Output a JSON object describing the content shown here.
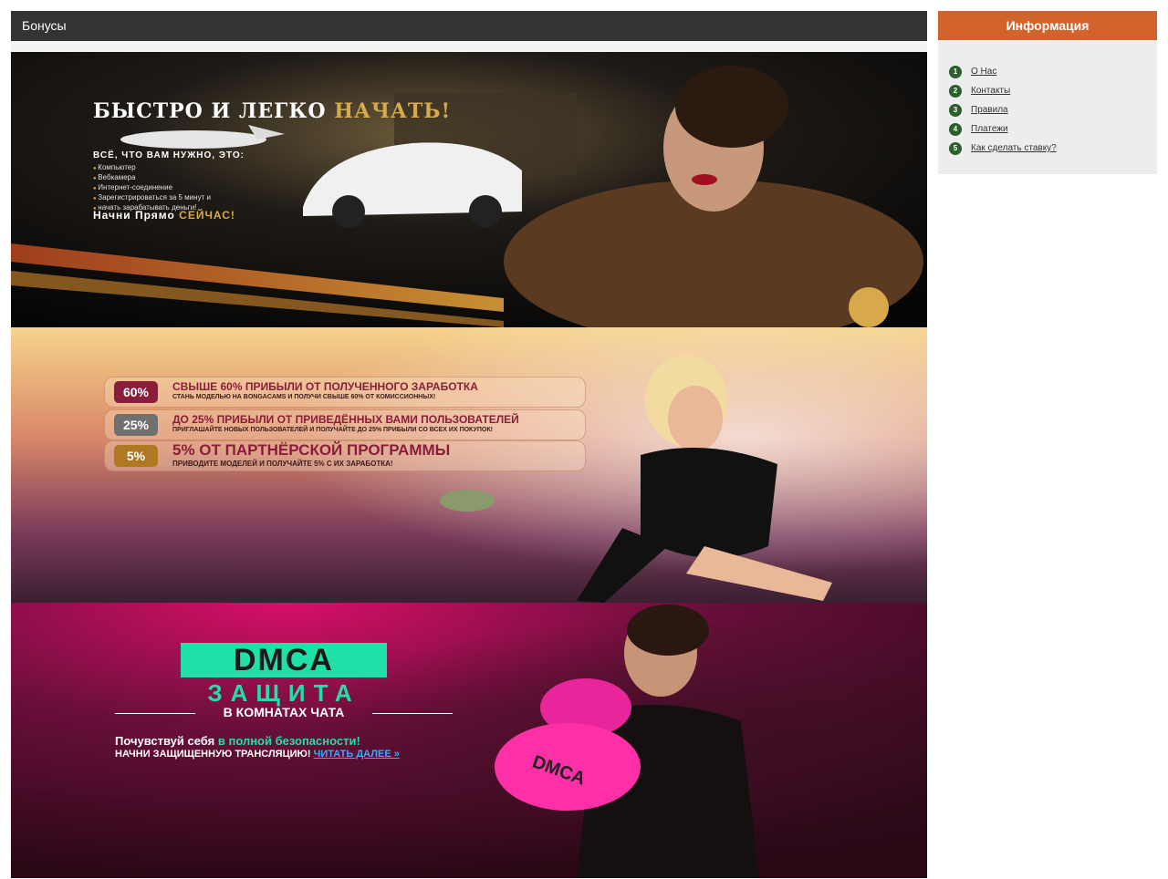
{
  "main": {
    "title": "Бонусы"
  },
  "banner1": {
    "title_white": "БЫСТРО И ЛЕГКО",
    "title_gold": "НАЧАТЬ!",
    "subtitle": "ВСЁ, ЧТО ВАМ НУЖНО, ЭТО:",
    "list": [
      "Компьютер",
      "Вебкамера",
      "Интернет-соединение",
      "Зарегистрироваться за 5 минут и",
      "начать зарабатывать деньги!"
    ],
    "cta_white": "Начни Прямо",
    "cta_gold": "СЕЙЧАС!"
  },
  "banner2": {
    "rows": [
      {
        "badge": "60%",
        "main": "СВЫШЕ 60% ПРИБЫЛИ ОТ ПОЛУЧЕННОГО ЗАРАБОТКА",
        "sub": "СТАНЬ МОДЕЛЬЮ НА BONGACAMS И ПОЛУЧИ СВЫШЕ 60% ОТ КОМИССИОННЫХ!"
      },
      {
        "badge": "25%",
        "main": "ДО 25% ПРИБЫЛИ ОТ ПРИВЕДЁННЫХ ВАМИ ПОЛЬЗОВАТЕЛЕЙ",
        "sub": "ПРИГЛАШАЙТЕ НОВЫХ ПОЛЬЗОВАТЕЛЕЙ И ПОЛУЧАЙТЕ ДО 25% ПРИБЫЛИ СО ВСЕХ ИХ ПОКУПОК!"
      },
      {
        "badge": "5%",
        "main": "5% ОТ ПАРТНЁРСКОЙ ПРОГРАММЫ",
        "sub": "ПРИВОДИТЕ МОДЕЛЕЙ И ПОЛУЧАЙТЕ 5% С ИХ ЗАРАБОТКА!"
      }
    ]
  },
  "banner3": {
    "dmca": "DMCA",
    "zashita": "ЗАЩИТА",
    "rooms": "В КОМНАТАХ ЧАТА",
    "feel_white": "Почувствуй себя",
    "feel_green": "в полной безопасности!",
    "start": "НАЧНИ ЗАЩИЩЕННУЮ ТРАНСЛЯЦИЮ!",
    "read_more": "ЧИТАТЬ ДАЛЕЕ »",
    "glove_text": "DMCA"
  },
  "sidebar": {
    "title": "Информация",
    "items": [
      {
        "num": "1",
        "label": "О Нас"
      },
      {
        "num": "2",
        "label": "Контакты"
      },
      {
        "num": "3",
        "label": "Правила"
      },
      {
        "num": "4",
        "label": "Платежи"
      },
      {
        "num": "5",
        "label": "Как сделать ставку?"
      }
    ]
  },
  "colors": {
    "header_bg": "#333333",
    "sidebar_header": "#d2632a",
    "number_badge": "#2d5e2d",
    "accent_gold": "#d7a94a",
    "accent_green": "#20e0a8"
  }
}
